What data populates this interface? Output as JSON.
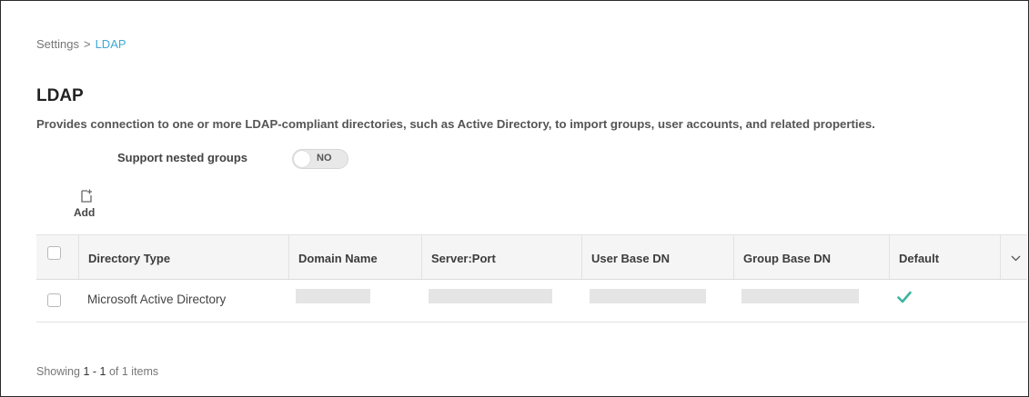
{
  "breadcrumb": {
    "parent": "Settings",
    "separator": ">",
    "current": "LDAP"
  },
  "page": {
    "title": "LDAP",
    "description": "Provides connection to one or more LDAP-compliant directories, such as Active Directory, to import groups, user accounts, and related properties."
  },
  "nested_groups": {
    "label": "Support nested groups",
    "value": "NO",
    "enabled": false
  },
  "toolbar": {
    "add_label": "Add",
    "add_icon": "add-document-icon"
  },
  "table": {
    "columns": [
      "Directory Type",
      "Domain Name",
      "Server:Port",
      "User Base DN",
      "Group Base DN",
      "Default"
    ],
    "rows": [
      {
        "directory_type": "Microsoft Active Directory",
        "domain_name": "",
        "server_port": "",
        "user_base_dn": "",
        "group_base_dn": "",
        "default": true
      }
    ],
    "column_menu_icon": "chevron-down-icon"
  },
  "footer": {
    "prefix": "Showing",
    "range_start": "1",
    "range_sep": "-",
    "range_end": "1",
    "of_label": "of 1 items"
  },
  "colors": {
    "accent": "#3fa9d3",
    "check": "#3cb4a0",
    "header_bg": "#f5f5f5"
  }
}
